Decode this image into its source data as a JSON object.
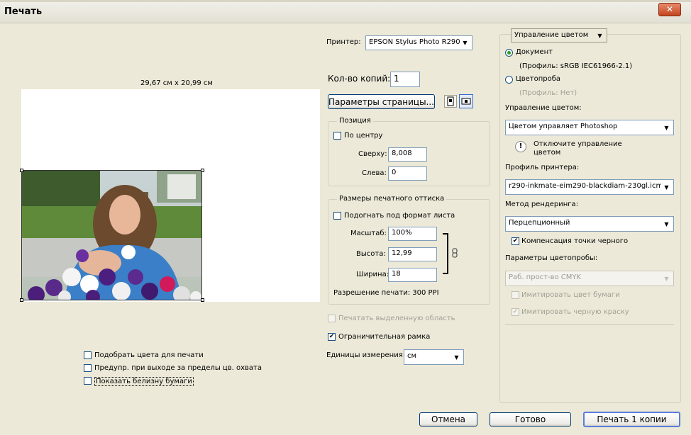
{
  "window": {
    "title": "Печать",
    "close_label": "✕"
  },
  "preview": {
    "size_label": "29,67 см x 20,99 см",
    "options": [
      {
        "label": "Подобрать цвета для печати",
        "checked": false
      },
      {
        "label": "Предупр. при выходе за пределы цв. охвата",
        "checked": false
      },
      {
        "label": "Показать белизну бумаги",
        "checked": false
      }
    ]
  },
  "printer": {
    "label": "Принтер:",
    "value": "EPSON Stylus Photo R290...",
    "copies_label": "Кол-во копий:",
    "copies_value": "1",
    "page_setup_label": "Параметры страницы..."
  },
  "position": {
    "title": "Позиция",
    "center_label": "По центру",
    "center_checked": false,
    "top_label": "Сверху:",
    "top_value": "8,008",
    "left_label": "Слева:",
    "left_value": "0"
  },
  "print_size": {
    "title": "Размеры печатного оттиска",
    "fit_label": "Подогнать под формат листа",
    "fit_checked": false,
    "scale_label": "Масштаб:",
    "scale_value": "100%",
    "height_label": "Высота:",
    "height_value": "12,99",
    "width_label": "Ширина:",
    "width_value": "18",
    "resolution_label": "Разрешение печати: 300 PPI"
  },
  "extra": {
    "print_selected_label": "Печатать выделенную область",
    "bounding_box_label": "Ограничительная рамка",
    "bounding_box_checked": true,
    "units_label": "Единицы измерения:",
    "units_value": "см"
  },
  "color": {
    "mode_dropdown": "Управление цветом",
    "document_label": "Документ",
    "document_profile": "(Профиль: sRGB IEC61966-2.1)",
    "proof_label": "Цветопроба",
    "proof_profile": "(Профиль: Нет)",
    "handling_label": "Управление цветом:",
    "handling_value": "Цветом управляет Photoshop",
    "warning_text_1": "Отключите управление",
    "warning_text_2": "цветом",
    "printer_profile_label": "Профиль принтера:",
    "printer_profile_value": "r290-inkmate-eim290-blackdiam-230gl.icm",
    "rendering_label": "Метод рендеринга:",
    "rendering_value": "Перцепционный",
    "bpc_label": "Компенсация точки черного",
    "bpc_checked": true,
    "proof_setup_label": "Параметры цветопробы:",
    "proof_setup_value": "Раб. прост-во CMYK",
    "simulate_paper_label": "Имитировать цвет бумаги",
    "simulate_black_label": "Имитировать черную краску"
  },
  "buttons": {
    "cancel": "Отмена",
    "done": "Готово",
    "print": "Печать 1 копии"
  },
  "colors": {
    "default_button_border": "#5a7edc",
    "radio_dot": "#21a121",
    "close_button": "#c2461f"
  }
}
